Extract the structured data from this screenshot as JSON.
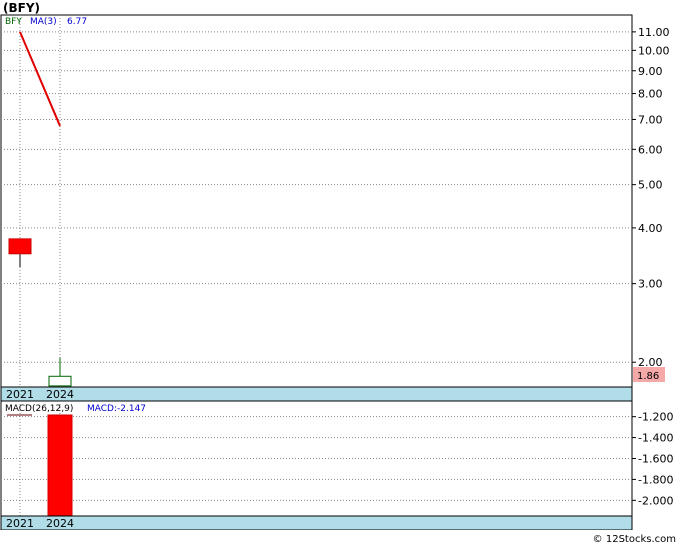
{
  "title": "(BFY)",
  "footer": "© 12Stocks.com",
  "colors": {
    "up": "#ffffff",
    "up_border": "#006600",
    "down": "#ff0000",
    "down_border": "#cc0000",
    "ma": "#e00000",
    "date_band": "#b0dde8",
    "grid": "#888888",
    "last_price_box": "#f4a8a8"
  },
  "chart_data": [
    {
      "type": "candlestick",
      "title": "(BFY)",
      "legend": {
        "ticker": "BFY",
        "ma_label": "MA(3)",
        "ma_value": "6.77"
      },
      "y_scale": "log",
      "ylim": [
        1.76,
        12.0
      ],
      "y_ticks": [
        "11.00",
        "10.00",
        "9.00",
        "8.00",
        "7.00",
        "6.00",
        "5.00",
        "4.00",
        "3.00",
        "2.00"
      ],
      "y_tick_values": [
        11,
        10,
        9,
        8,
        7,
        6,
        5,
        4,
        3,
        2
      ],
      "x_labels": [
        "2021",
        "2024"
      ],
      "candles": [
        {
          "period": "2021",
          "open": 3.78,
          "high": 3.78,
          "low": 3.27,
          "close": 3.5,
          "direction": "down"
        },
        {
          "period": "2024",
          "open": 1.77,
          "high": 2.05,
          "low": 1.77,
          "close": 1.86,
          "direction": "up"
        }
      ],
      "moving_average": {
        "name": "MA(3)",
        "values": [
          11.0,
          6.77
        ]
      },
      "last_price": "1.86"
    },
    {
      "type": "bar",
      "legend": {
        "line_label": "MACD(26,12,9)",
        "value_label": "MACD:-2.147"
      },
      "ylim": [
        -2.15,
        -1.05
      ],
      "y_ticks": [
        "-1.200",
        "-1.400",
        "-1.600",
        "-1.800",
        "-2.000"
      ],
      "y_tick_values": [
        -1.2,
        -1.4,
        -1.6,
        -1.8,
        -2.0
      ],
      "x_labels": [
        "2021",
        "2024"
      ],
      "bars": [
        {
          "period": "2024",
          "value": -2.147
        }
      ]
    }
  ]
}
